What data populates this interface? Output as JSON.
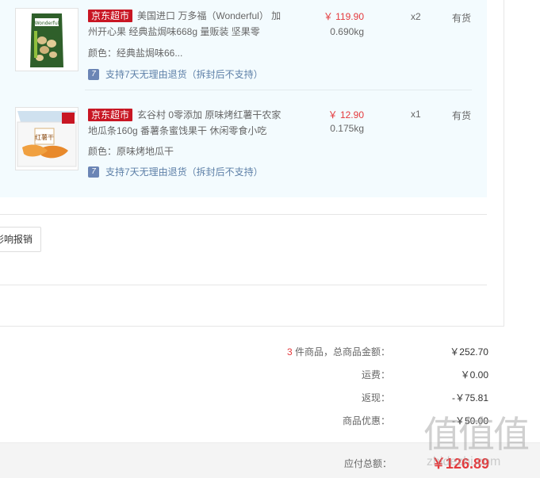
{
  "items": [
    {
      "tag": "京东超市",
      "title": "美国进口 万多福（Wonderful） 加州开心果 经典盐焗味668g 量贩装 坚果零",
      "attr": "颜色：经典盐焗味66...",
      "return_policy": "支持7天无理由退货（拆封后不支持）",
      "price": "￥ 119.90",
      "weight": "0.690kg",
      "qty": "x2",
      "stock": "有货",
      "thumb_brand": "Wonderful"
    },
    {
      "tag": "京东超市",
      "title": "玄谷村 0零添加 原味烤红薯干农家地瓜条160g 番薯条蜜饯果干 休闲零食小吃",
      "attr": "颜色：原味烤地瓜干",
      "return_policy": "支持7天无理由退货（拆封后不支持）",
      "price": "￥ 12.90",
      "weight": "0.175kg",
      "qty": "x1",
      "stock": "有货",
      "thumb_brand": "红薯干"
    }
  ],
  "invoice_button": "影响报销",
  "summary": {
    "count": "3",
    "count_label": " 件商品，总商品金额：",
    "goods_total": "￥252.70",
    "shipping_label": "运费：",
    "shipping": "￥0.00",
    "cashback_label": "返现：",
    "cashback": "-￥75.81",
    "discount_label": "商品优惠：",
    "discount": "-￥50.00",
    "payable_label": "应付总额：",
    "payable": "￥126.89"
  },
  "watermark": {
    "logo": "值值值",
    "url": "zhidezhi.com"
  },
  "colors": {
    "accent_red": "#e4393c",
    "tag_red": "#c81623",
    "panel_bg": "#f3fbfe",
    "link_blue": "#5e80a8"
  }
}
